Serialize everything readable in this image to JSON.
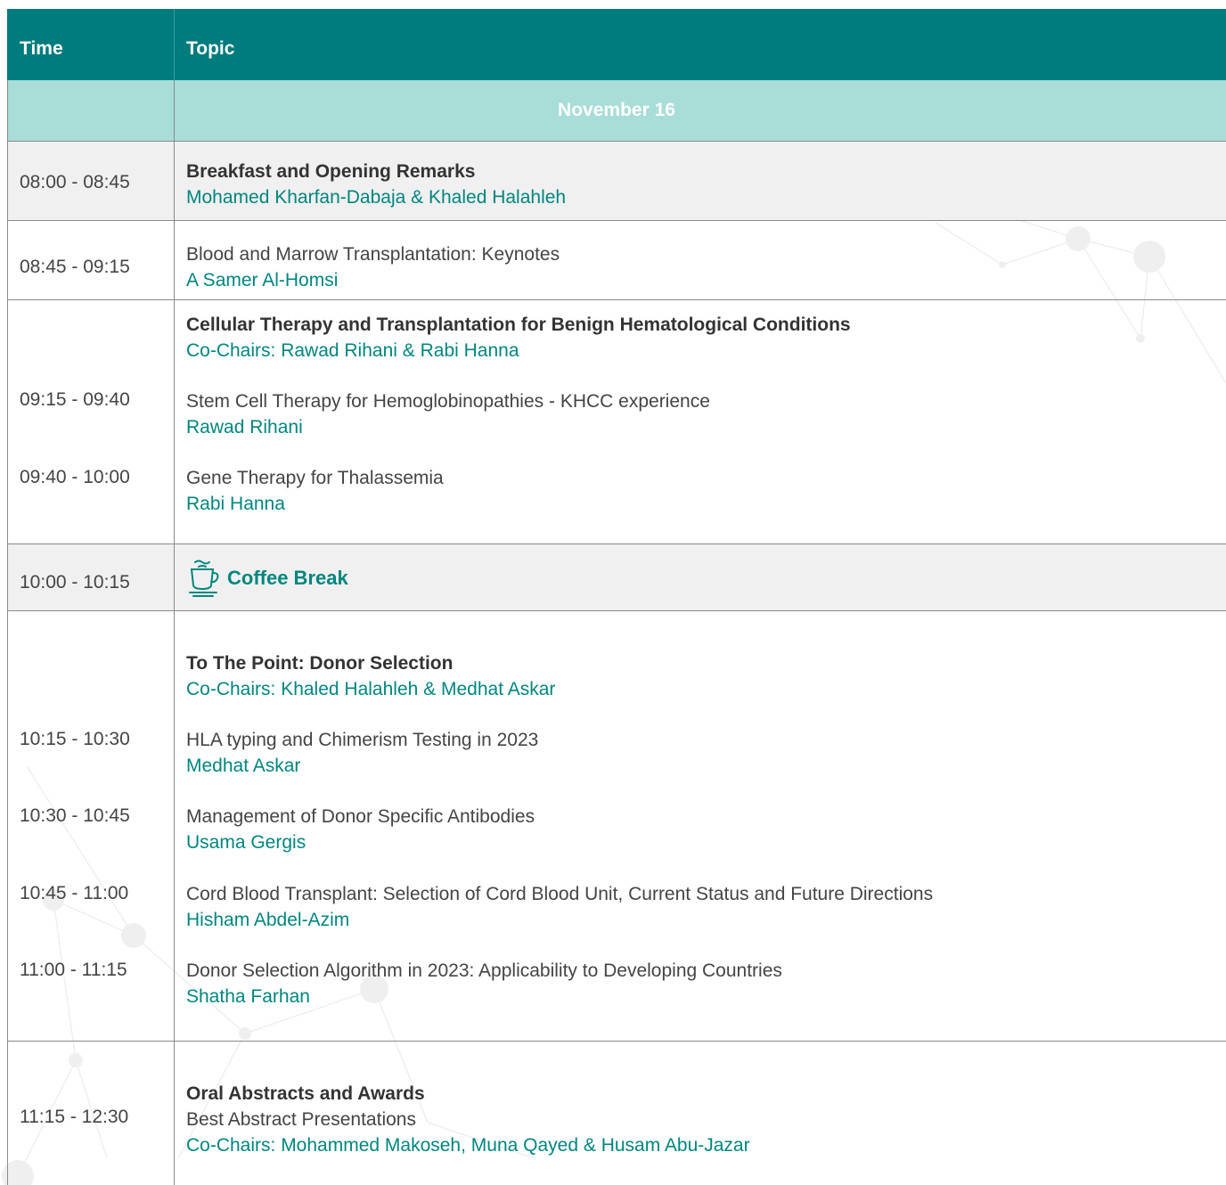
{
  "header": {
    "time_label": "Time",
    "topic_label": "Topic"
  },
  "day": "November 16",
  "colors": {
    "header": "#007b7e",
    "day_band": "#a8ddd8",
    "speaker": "#00867f",
    "shade": "#f0f0f0"
  },
  "sessions": [
    {
      "time": "08:00 - 08:45",
      "title": "Breakfast and Opening Remarks",
      "speaker": "Mohamed Kharfan-Dabaja & Khaled Halahleh"
    },
    {
      "time": "08:45 - 09:15",
      "title": "Blood and Marrow Transplantation: Keynotes",
      "speaker": "A Samer Al-Homsi"
    },
    {
      "title": "Cellular Therapy and Transplantation for Benign Hematological Conditions",
      "chairs": "Co-Chairs: Rawad Rihani & Rabi Hanna",
      "talks": [
        {
          "time": "09:15 - 09:40",
          "title": "Stem Cell Therapy for Hemoglobinopathies - KHCC experience",
          "speaker": "Rawad Rihani"
        },
        {
          "time": "09:40 - 10:00",
          "title": "Gene Therapy for Thalassemia",
          "speaker": "Rabi Hanna"
        }
      ]
    },
    {
      "time": "10:00 - 10:15",
      "title": "Coffee Break",
      "icon": "coffee-cup-icon"
    },
    {
      "title": "To The Point: Donor Selection",
      "chairs": "Co-Chairs: Khaled Halahleh & Medhat Askar",
      "talks": [
        {
          "time": "10:15 - 10:30",
          "title": "HLA typing and Chimerism Testing in 2023",
          "speaker": "Medhat Askar"
        },
        {
          "time": "10:30 - 10:45",
          "title": "Management of Donor Specific Antibodies",
          "speaker": "Usama Gergis"
        },
        {
          "time": "10:45 - 11:00",
          "title": "Cord Blood Transplant: Selection of Cord Blood Unit, Current Status and Future Directions",
          "speaker": "Hisham Abdel-Azim"
        },
        {
          "time": "11:00 - 11:15",
          "title": "Donor Selection Algorithm in 2023: Applicability to Developing Countries",
          "speaker": "Shatha Farhan"
        }
      ]
    },
    {
      "time": "11:15 - 12:30",
      "title": "Oral Abstracts and Awards",
      "subtitle": "Best Abstract Presentations",
      "chairs": "Co-Chairs: Mohammed Makoseh, Muna Qayed & Husam Abu-Jazar"
    }
  ]
}
